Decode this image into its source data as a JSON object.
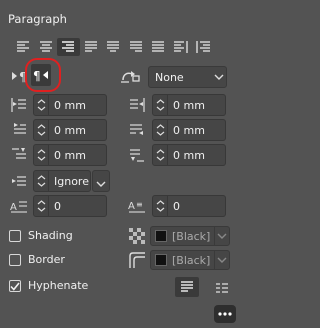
{
  "panel": {
    "title": "Paragraph"
  },
  "alignment": {
    "buttons": [
      "align-left-icon",
      "align-center-icon",
      "align-right-icon",
      "justify-last-left-icon",
      "justify-last-center-icon",
      "justify-last-right-icon",
      "justify-all-icon",
      "align-towards-spine-icon",
      "align-away-from-spine-icon"
    ],
    "selected_index": 2
  },
  "direction": {
    "ltr_icon": "ltr-paragraph-icon",
    "rtl_icon": "rtl-paragraph-icon",
    "selected": "rtl-paragraph-icon"
  },
  "bullets": {
    "icon": "bullets-numbering-icon",
    "value": "None"
  },
  "fields": {
    "left_indent": "0 mm",
    "right_indent": "0 mm",
    "first_line_indent": "0 mm",
    "last_line_indent": "0 mm",
    "space_before": "0 mm",
    "space_after": "0 mm",
    "align_to_grid": "Ignore",
    "drop_cap_lines": "0",
    "drop_cap_chars": "0"
  },
  "shading": {
    "label": "Shading",
    "checked": false,
    "color": "[Black]"
  },
  "border": {
    "label": "Border",
    "checked": false,
    "color": "[Black]"
  },
  "hyphenate": {
    "label": "Hyphenate",
    "checked": true
  },
  "colors": {
    "bg": "#535353",
    "field": "#464646",
    "highlight": "#e02020"
  }
}
